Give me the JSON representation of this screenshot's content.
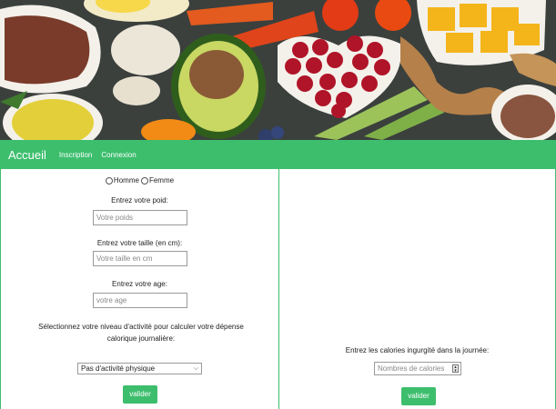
{
  "navbar": {
    "brand": "Accueil",
    "links": [
      "Inscription",
      "Connexion"
    ]
  },
  "left_form": {
    "gender_options": [
      "Homme",
      "Femme"
    ],
    "weight_label": "Entrez votre poid:",
    "weight_placeholder": "Votre poids",
    "height_label": "Entrez votre taille (en cm):",
    "height_placeholder": "Votre taille en cm",
    "age_label": "Entrez votre age:",
    "age_placeholder": "votre age",
    "activity_label": "Sélectionnez votre niveau d'activité pour calculer votre dépense calorique journalière:",
    "activity_selected": "Pas d'activité physique",
    "submit_label": "valider"
  },
  "right_form": {
    "calories_label": "Entrez les calories ingurgité dans la journée:",
    "calories_placeholder": "Nombres de calories",
    "submit_label": "valider"
  },
  "colors": {
    "accent": "#3dbe6d"
  }
}
